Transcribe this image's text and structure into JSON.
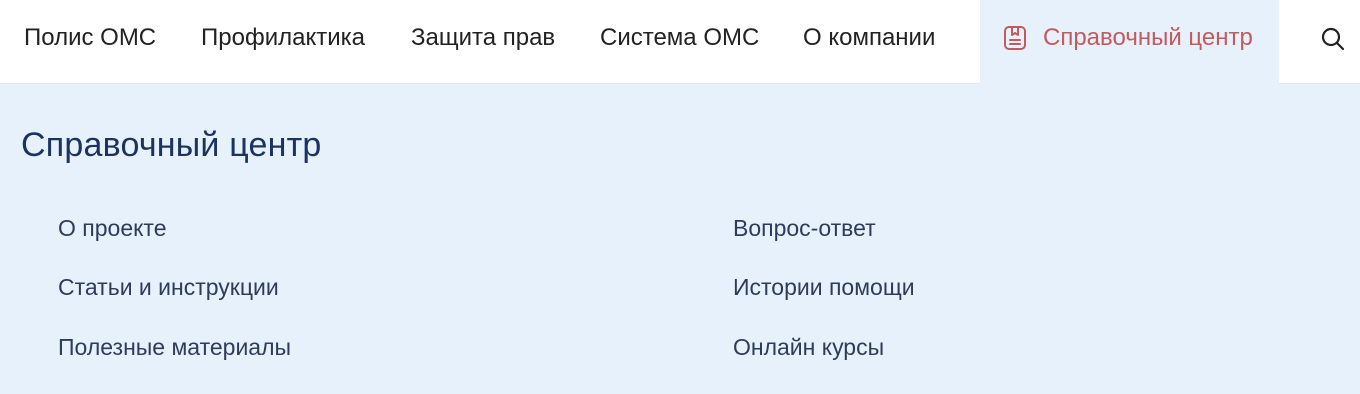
{
  "topnav": {
    "items": [
      {
        "label": "Полис ОМС"
      },
      {
        "label": "Профилактика"
      },
      {
        "label": "Защита прав"
      },
      {
        "label": "Система ОМС"
      },
      {
        "label": "О компании"
      }
    ],
    "active": {
      "label": "Справочный центр",
      "icon": "book-icon",
      "color": "#c45a5e"
    },
    "search_icon": "search-icon"
  },
  "dropdown": {
    "title": "Справочный центр",
    "left_links": [
      {
        "label": "О проекте"
      },
      {
        "label": "Статьи и инструкции"
      },
      {
        "label": "Полезные материалы"
      }
    ],
    "right_links": [
      {
        "label": "Вопрос-ответ"
      },
      {
        "label": "Истории помощи"
      },
      {
        "label": "Онлайн курсы"
      }
    ],
    "background": "#e7f1fc"
  }
}
